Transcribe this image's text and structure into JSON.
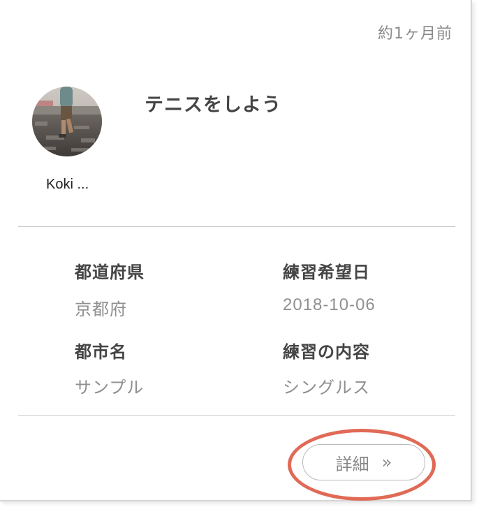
{
  "card": {
    "timestamp": "約1ヶ月前",
    "title": "テニスをしよう",
    "user": {
      "name": "Koki ..."
    },
    "fields": {
      "prefecture_label": "都道府県",
      "prefecture_value": "京都府",
      "date_label": "練習希望日",
      "date_value": "2018-10-06",
      "city_label": "都市名",
      "city_value": "サンプル",
      "content_label": "練習の内容",
      "content_value": "シングルス"
    },
    "detail_button": {
      "label": "詳細",
      "chevron": "»"
    },
    "highlight_color": "#e06a56"
  }
}
